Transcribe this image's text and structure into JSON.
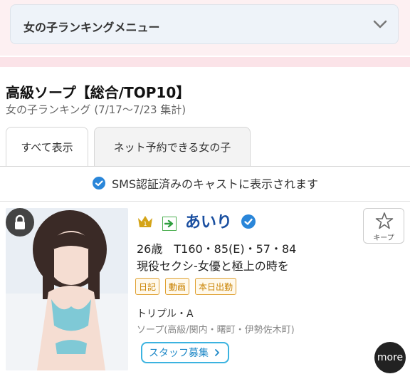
{
  "menu": {
    "title": "女の子ランキングメニュー"
  },
  "ranking": {
    "title": "高級ソープ【総合/TOP10】",
    "subtitle": "女の子ランキング (7/17〜7/23 集計)"
  },
  "tabs": [
    {
      "label": "すべて表示",
      "active": true
    },
    {
      "label": "ネット予約できる女の子",
      "active": false
    }
  ],
  "notice": {
    "text": "SMS認証済みのキャストに表示されます"
  },
  "cast": {
    "rank": "1",
    "name": "あいり",
    "stats": "26歳　T160・85(E)・57・84",
    "catchphrase": "現役セクシ-女優と極上の時を",
    "tags": [
      "日記",
      "動画",
      "本日出勤"
    ],
    "shop": "トリプル・A",
    "area": "ソープ(高級/関内・曙町・伊勢佐木町)",
    "favorite_label": "キープ",
    "staff_label": "スタッフ募集",
    "more_label": "more"
  },
  "colors": {
    "accent": "#1a4fa0",
    "tag": "#e0a133",
    "verified": "#2a86d9",
    "staff": "#3bb3e0"
  }
}
